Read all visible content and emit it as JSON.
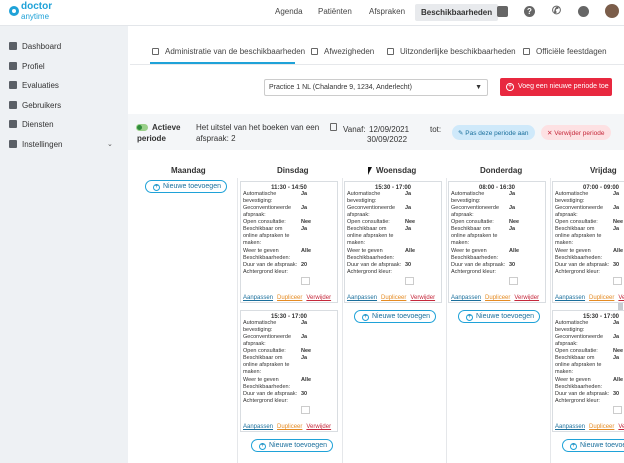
{
  "brand": {
    "line1": "doctor",
    "line2": "anytime"
  },
  "nav": {
    "agenda": "Agenda",
    "patienten": "Patiënten",
    "afspraken": "Afspraken",
    "beschikbaarheden": "Beschikbaarheden"
  },
  "sidebar": {
    "items": [
      {
        "label": "Dashboard"
      },
      {
        "label": "Profiel"
      },
      {
        "label": "Evaluaties"
      },
      {
        "label": "Gebruikers"
      },
      {
        "label": "Diensten"
      },
      {
        "label": "Instellingen"
      }
    ]
  },
  "tabs": [
    {
      "label": "Administratie van de beschikbaarheden"
    },
    {
      "label": "Afwezigheden"
    },
    {
      "label": "Uitzonderlijke beschikbaarheden"
    },
    {
      "label": "Officiële feestdagen"
    }
  ],
  "practice": {
    "selected": "Practice 1 NL (Chalandre 9, 1234, Anderlecht)"
  },
  "add_period_label": "Voeg een nieuwe periode toe",
  "period": {
    "status": "Actieve",
    "status2": "periode",
    "uitstel1": "Het uitstel van het boeken van een",
    "uitstel2": "afspraak: 2",
    "vanaf": "Vanaf:",
    "from": "12/09/2021",
    "to": "30/09/2022",
    "tot": "tot:",
    "pause": "Pas deze periode aan",
    "delete": "Verwijder periode"
  },
  "days": [
    "Maandag",
    "Dinsdag",
    "Woensdag",
    "Donderdag",
    "Vrijdag"
  ],
  "add_label": "Nieuwe toevoegen",
  "labels": {
    "auto1": "Automatische",
    "auto2": "bevestiging:",
    "conv1": "Geconventioneerde",
    "conv2": "afspraak:",
    "open": "Open consultatie:",
    "online1": "Beschikbaar om",
    "online2": "online afspraken te",
    "online3": "maken:",
    "weer1": "Weer te geven",
    "weer2": "Beschikbaarheden:",
    "duur": "Duur van de afspraak:",
    "kleur": "Achtergrond kleur:"
  },
  "links": {
    "edit": "Aanpassen",
    "dup": "Dupliceer",
    "del": "Verwijder"
  },
  "cards": {
    "c1": {
      "time": "11:30 - 14:50",
      "auto": "Ja",
      "conv": "Ja",
      "open": "Nee",
      "online": "Ja",
      "weer": "Alle",
      "duur": "20"
    },
    "c2": {
      "time": "15:30 - 17:00",
      "auto": "Ja",
      "conv": "Ja",
      "open": "Nee",
      "online": "Ja",
      "weer": "Alle",
      "duur": "30"
    },
    "c3": {
      "time": "15:30 - 17:00",
      "auto": "Ja",
      "conv": "Ja",
      "open": "Nee",
      "online": "Ja",
      "weer": "Alle",
      "duur": "30"
    },
    "c4": {
      "time": "08:00 - 16:30",
      "auto": "Ja",
      "conv": "Ja",
      "open": "Nee",
      "online": "Ja",
      "weer": "Alle",
      "duur": "30"
    },
    "c5": {
      "time": "07:00 - 09:00",
      "auto": "Ja",
      "conv": "Ja",
      "open": "Nee",
      "online": "Ja",
      "weer": "Alle",
      "duur": "30"
    },
    "c6": {
      "time": "15:30 - 17:00",
      "auto": "Ja",
      "conv": "Ja",
      "open": "Nee",
      "online": "Ja",
      "weer": "Alle",
      "duur": "30"
    }
  },
  "colors": {
    "accent": "#1fa2d8",
    "danger": "#e8283f"
  }
}
